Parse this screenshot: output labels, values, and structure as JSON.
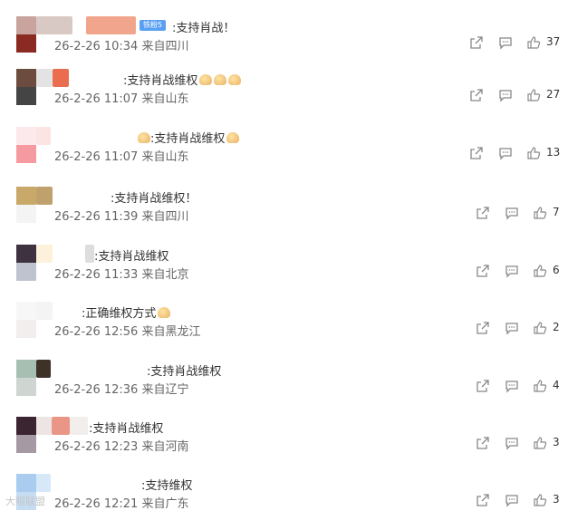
{
  "comments": [
    {
      "text": ":支持肖战！",
      "badge": "铁粉5",
      "meta": "26-2-26 10:34 来自四川",
      "likes": "37",
      "emojis": 0
    },
    {
      "text": ":支持肖战维权",
      "meta": "26-2-26 11:07 来自山东",
      "likes": "27",
      "emojis": 3
    },
    {
      "text": ":支持肖战维权",
      "meta": "26-2-26 11:07 来自山东",
      "likes": "13",
      "emojis": 1
    },
    {
      "text": ":支持肖战维权！",
      "meta": "26-2-26 11:39 来自四川",
      "likes": "7",
      "emojis": 0
    },
    {
      "text": ":支持肖战维权",
      "meta": "26-2-26 11:33 来自北京",
      "likes": "6",
      "emojis": 0
    },
    {
      "text": ":正确维权方式",
      "meta": "26-2-26 12:56 来自黑龙江",
      "likes": "2",
      "emojis": 1
    },
    {
      "text": ":支持肖战维权",
      "meta": "26-2-26 12:36 来自辽宁",
      "likes": "4",
      "emojis": 0
    },
    {
      "text": ":支持肖战维权",
      "meta": "26-2-26 12:23 来自河南",
      "likes": "3",
      "emojis": 0
    },
    {
      "text": ":支持维权",
      "meta": "26-2-26 12:21 来自广东",
      "likes": "3",
      "emojis": 0
    }
  ],
  "watermark": "大眼联盟",
  "icons": {
    "share": "share-icon",
    "comment": "comment-icon",
    "like": "thumbs-up-icon"
  },
  "colors": {
    "badge": "#5aa0f2",
    "meta": "#666666",
    "icon": "#888888"
  }
}
